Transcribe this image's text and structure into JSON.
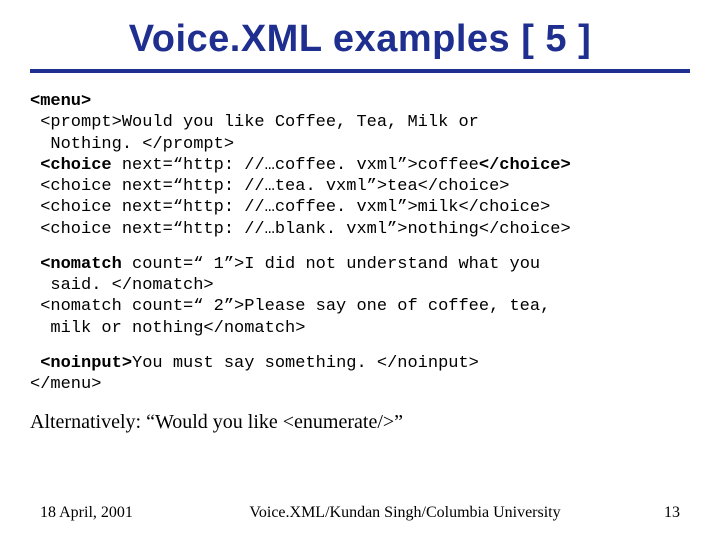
{
  "title": "Voice.XML examples [ 5 ]",
  "code": {
    "menu_open": "<menu>",
    "prompt_line1": " <prompt>Would you like Coffee, Tea, Milk or",
    "prompt_line2": "  Nothing. </prompt>",
    "choice1a": " <choice",
    "choice1b": " next=“http: //…coffee. vxml”>coffee",
    "choice1c": "</choice>",
    "choice2": " <choice next=“http: //…tea. vxml”>tea</choice>",
    "choice3": " <choice next=“http: //…coffee. vxml”>milk</choice>",
    "choice4": " <choice next=“http: //…blank. vxml”>nothing</choice>",
    "nomatch1a": " <nomatch",
    "nomatch1b": " count=“ 1”>I did not understand what you",
    "nomatch1c": "  said. </nomatch>",
    "nomatch2a": " <nomatch count=“ 2”>Please say one of coffee, tea,",
    "nomatch2b": "  milk or nothing</nomatch>",
    "noinput_a": " <noinput>",
    "noinput_b": "You must say something. </noinput>",
    "menu_close": "</menu>"
  },
  "alt": "Alternatively: “Would you like <enumerate/>”",
  "footer": {
    "left": "18 April, 2001",
    "center": "Voice.XML/Kundan Singh/Columbia University",
    "right": "13"
  }
}
